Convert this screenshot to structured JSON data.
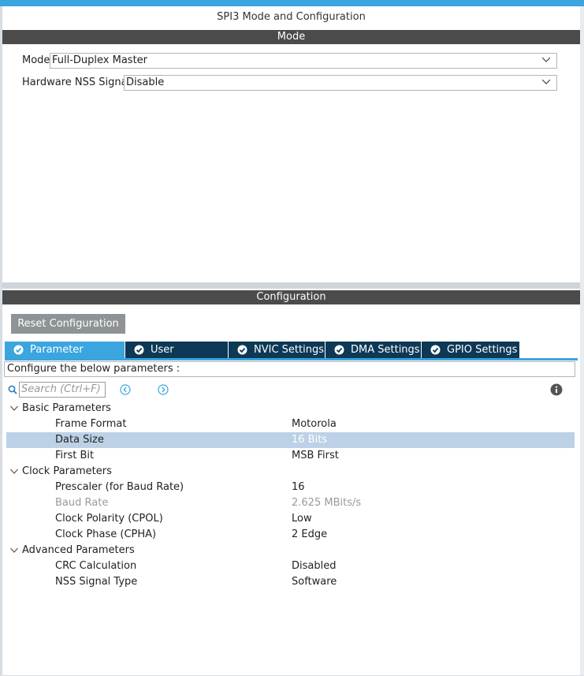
{
  "window": {
    "title": "SPI3 Mode and Configuration"
  },
  "mode_section": {
    "header": "Mode",
    "mode": {
      "label": "Mode",
      "value": "Full-Duplex Master"
    },
    "nss": {
      "label": "Hardware NSS Signal",
      "value": "Disable"
    }
  },
  "config_section": {
    "header": "Configuration",
    "reset_button": "Reset Configuration",
    "tabs": [
      {
        "label": "Parameter Settings"
      },
      {
        "label": "User Constants"
      },
      {
        "label": "NVIC Settings"
      },
      {
        "label": "DMA Settings"
      },
      {
        "label": "GPIO Settings"
      }
    ],
    "description": "Configure the below parameters :",
    "search_placeholder": "Search (Ctrl+F)"
  },
  "params": {
    "groups": [
      {
        "label": "Basic Parameters",
        "rows": [
          {
            "name": "Frame Format",
            "value": "Motorola"
          },
          {
            "name": "Data Size",
            "value": "16 Bits"
          },
          {
            "name": "First Bit",
            "value": "MSB First"
          }
        ]
      },
      {
        "label": "Clock Parameters",
        "rows": [
          {
            "name": "Prescaler (for Baud Rate)",
            "value": "16"
          },
          {
            "name": "Baud Rate",
            "value": "2.625 MBits/s"
          },
          {
            "name": "Clock Polarity (CPOL)",
            "value": "Low"
          },
          {
            "name": "Clock Phase (CPHA)",
            "value": "2 Edge"
          }
        ]
      },
      {
        "label": "Advanced Parameters",
        "rows": [
          {
            "name": "CRC Calculation",
            "value": "Disabled"
          },
          {
            "name": "NSS Signal Type",
            "value": "Software"
          }
        ]
      }
    ]
  },
  "colors": {
    "accent": "#3aa5de",
    "tab_dark": "#0d3856",
    "header_bar": "#4b4b4b",
    "selected_row": "#bcd1e6"
  }
}
